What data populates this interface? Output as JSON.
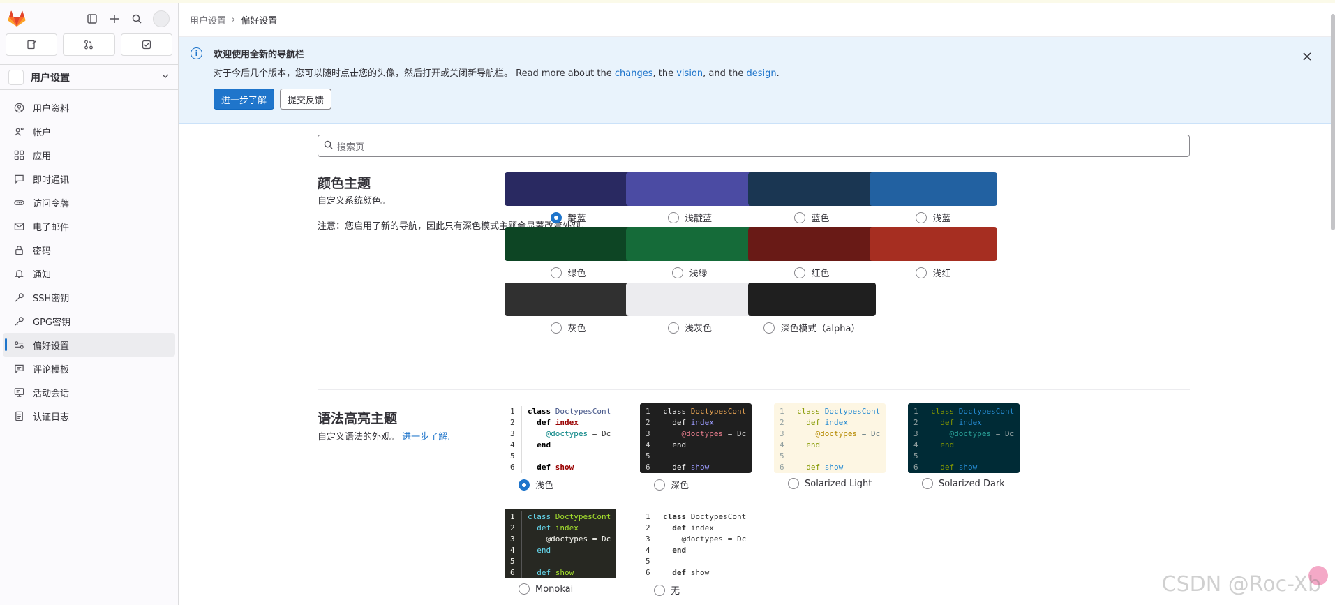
{
  "sidebar": {
    "context": "用户设置",
    "items": [
      {
        "label": "用户资料",
        "icon": "profile-icon"
      },
      {
        "label": "帐户",
        "icon": "account-icon"
      },
      {
        "label": "应用",
        "icon": "applications-icon"
      },
      {
        "label": "即时通讯",
        "icon": "chat-icon"
      },
      {
        "label": "访问令牌",
        "icon": "token-icon"
      },
      {
        "label": "电子邮件",
        "icon": "mail-icon"
      },
      {
        "label": "密码",
        "icon": "lock-icon"
      },
      {
        "label": "通知",
        "icon": "bell-icon"
      },
      {
        "label": "SSH密钥",
        "icon": "key-icon"
      },
      {
        "label": "GPG密钥",
        "icon": "key-icon"
      },
      {
        "label": "偏好设置",
        "icon": "preferences-icon",
        "active": true
      },
      {
        "label": "评论模板",
        "icon": "comment-icon"
      },
      {
        "label": "活动会话",
        "icon": "monitor-icon"
      },
      {
        "label": "认证日志",
        "icon": "log-icon"
      }
    ]
  },
  "breadcrumb": {
    "parent": "用户设置",
    "current": "偏好设置"
  },
  "banner": {
    "title": "欢迎使用全新的导航栏",
    "text_prefix": "对于今后几个版本，您可以随时点击您的头像，然后打开或关闭新导航栏。 Read more about the",
    "link_changes": "changes",
    "text_mid1": ", the",
    "link_vision": "vision",
    "text_mid2": ", and the",
    "link_design": "design",
    "text_end": ".",
    "btn_learn": "进一步了解",
    "btn_feedback": "提交反馈"
  },
  "search": {
    "placeholder": "搜索页"
  },
  "color_theme": {
    "title": "颜色主题",
    "desc": "自定义系统颜色。",
    "note": "注意：您启用了新的导航，因此只有深色模式主题会显著改变外观。",
    "themes": [
      {
        "label": "靛蓝",
        "color": "#292961",
        "selected": true
      },
      {
        "label": "浅靛蓝",
        "color": "#4b4ba3",
        "selected": false
      },
      {
        "label": "蓝色",
        "color": "#1a3652",
        "selected": false
      },
      {
        "label": "浅蓝",
        "color": "#2261a1",
        "selected": false
      },
      {
        "label": "绿色",
        "color": "#0d4524",
        "selected": false
      },
      {
        "label": "浅绿",
        "color": "#156b39",
        "selected": false
      },
      {
        "label": "红色",
        "color": "#691a16",
        "selected": false
      },
      {
        "label": "浅红",
        "color": "#a62e21",
        "selected": false
      },
      {
        "label": "灰色",
        "color": "#303030",
        "selected": false
      },
      {
        "label": "浅灰色",
        "color": "#ececef",
        "selected": false
      },
      {
        "label": "深色模式（alpha）",
        "color": "#1f1f1f",
        "selected": false
      }
    ]
  },
  "syntax_theme": {
    "title": "语法高亮主题",
    "desc": "自定义语法的外观。",
    "link": "进一步了解.",
    "themes": [
      {
        "label": "浅色",
        "selected": true
      },
      {
        "label": "深色",
        "selected": false
      },
      {
        "label": "Solarized Light",
        "selected": false
      },
      {
        "label": "Solarized Dark",
        "selected": false
      },
      {
        "label": "Monokai",
        "selected": false
      },
      {
        "label": "无",
        "selected": false
      }
    ],
    "code_lines": [
      "class DoctypesCont",
      "  def index",
      "    @doctypes = Dc",
      "  end",
      "",
      "  def show"
    ]
  },
  "watermark": "CSDN @Roc-Xb"
}
